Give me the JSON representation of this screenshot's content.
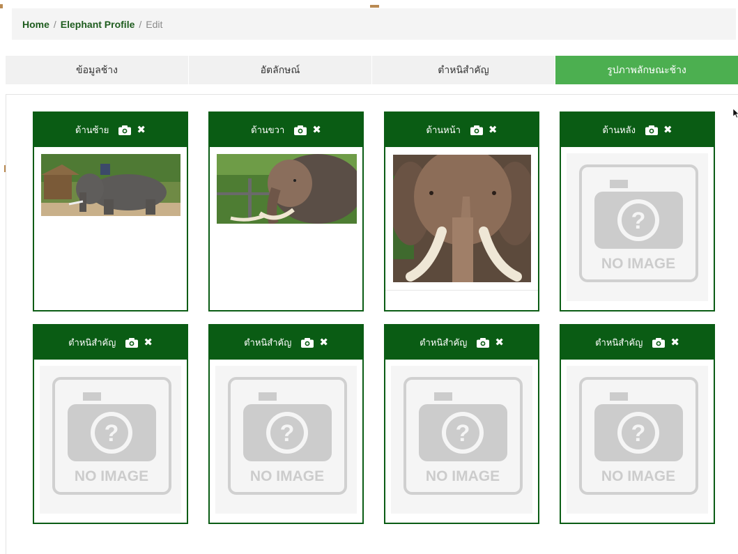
{
  "breadcrumb": {
    "home": "Home",
    "profile": "Elephant Profile",
    "current": "Edit",
    "separator": "/"
  },
  "tabs": [
    {
      "label": "ข้อมูลช้าง",
      "active": false
    },
    {
      "label": "อัตลักษณ์",
      "active": false
    },
    {
      "label": "ตำหนิสำคัญ",
      "active": false
    },
    {
      "label": "รูปภาพลักษณะช้าง",
      "active": true
    }
  ],
  "cards": [
    {
      "title": "ด้านซ้าย",
      "image": "elephant-left-side-photo"
    },
    {
      "title": "ด้านขวา",
      "image": "elephant-right-side-photo"
    },
    {
      "title": "ด้านหน้า",
      "image": "elephant-front-photo"
    },
    {
      "title": "ด้านหลัง",
      "image": "no-image"
    },
    {
      "title": "ตำหนิสำคัญ",
      "image": "no-image"
    },
    {
      "title": "ตำหนิสำคัญ",
      "image": "no-image"
    },
    {
      "title": "ตำหนิสำคัญ",
      "image": "no-image"
    },
    {
      "title": "ตำหนิสำคัญ",
      "image": "no-image"
    }
  ],
  "placeholder_text": "NO IMAGE",
  "icons": {
    "upload": "camera-icon",
    "remove": "close-icon"
  },
  "colors": {
    "header_green": "#0a5c14",
    "active_tab": "#4caf50",
    "link_green": "#1e5c1e"
  }
}
